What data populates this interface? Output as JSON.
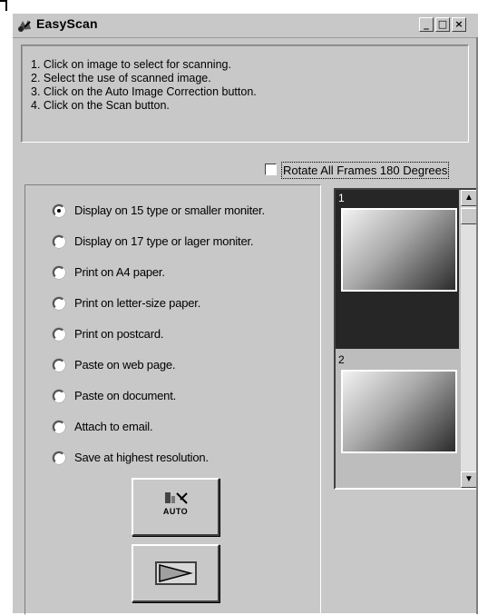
{
  "window": {
    "title": "EasyScan",
    "minimize_label": "_",
    "maximize_label": "□",
    "close_label": "×"
  },
  "instructions": [
    "1. Click on image to select for scanning.",
    "2. Select the use of scanned image.",
    "3. Click on the Auto Image Correction button.",
    "4. Click on the Scan button."
  ],
  "rotate": {
    "label": "Rotate All Frames 180 Degrees",
    "checked": false
  },
  "options": [
    {
      "label": "Display on 15 type or smaller moniter.",
      "selected": true
    },
    {
      "label": "Display on 17 type or lager moniter.",
      "selected": false
    },
    {
      "label": "Print on A4 paper.",
      "selected": false
    },
    {
      "label": "Print on letter-size paper.",
      "selected": false
    },
    {
      "label": "Print on postcard.",
      "selected": false
    },
    {
      "label": "Paste on web page.",
      "selected": false
    },
    {
      "label": "Paste on document.",
      "selected": false
    },
    {
      "label": "Attach to email.",
      "selected": false
    },
    {
      "label": "Save at highest resolution.",
      "selected": false
    }
  ],
  "buttons": {
    "auto_label": "AUTO"
  },
  "frames": [
    {
      "number": "1",
      "selected": true
    },
    {
      "number": "2",
      "selected": false
    }
  ],
  "scroll": {
    "up_label": "▲",
    "down_label": "▼"
  }
}
